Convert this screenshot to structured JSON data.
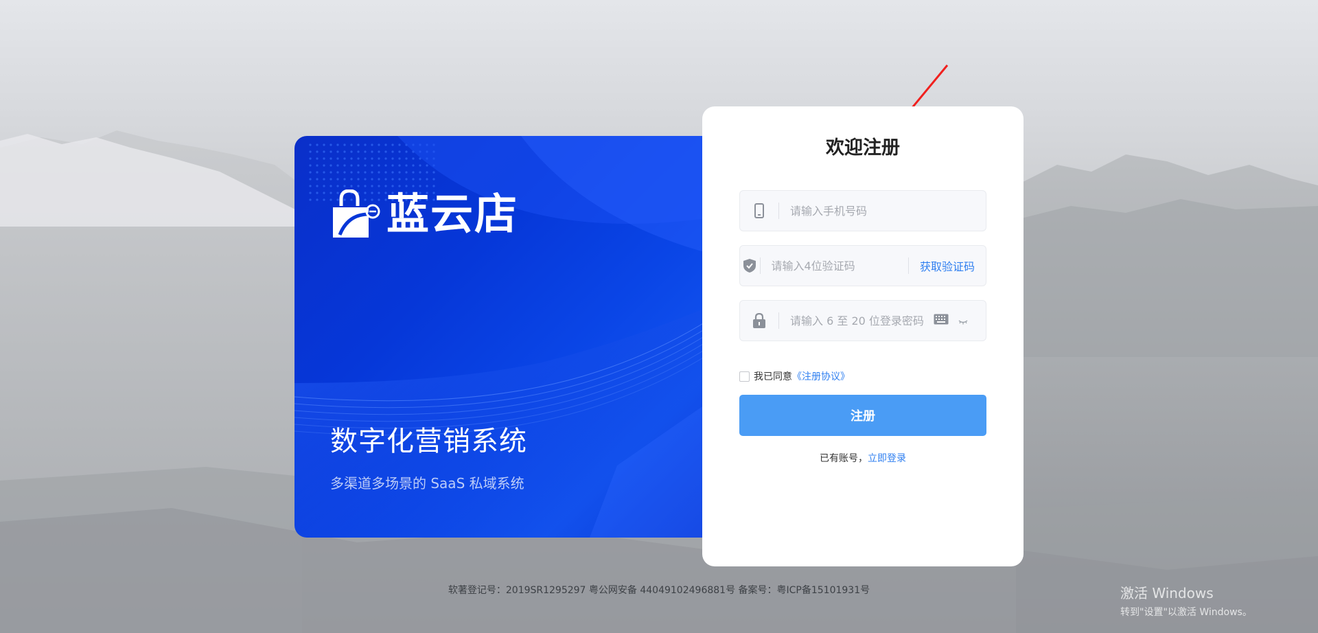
{
  "promo": {
    "brand_name": "蓝云店",
    "title": "数字化营销系统",
    "subtitle": "多渠道多场景的 SaaS 私域系统"
  },
  "register": {
    "title": "欢迎注册",
    "phone_placeholder": "请输入手机号码",
    "code_placeholder": "请输入4位验证码",
    "get_code_label": "获取验证码",
    "password_placeholder": "请输入 6 至 20 位登录密码",
    "agree_prefix": "我已同意",
    "agree_link": "《注册协议》",
    "submit_label": "注册",
    "login_prefix": "已有账号，",
    "login_link": "立即登录"
  },
  "footer": {
    "text": "软著登记号：2019SR1295297 粤公网安备 44049102496881号  备案号：粤ICP备15101931号"
  },
  "watermark": {
    "line1": "激活 Windows",
    "line2": "转到\"设置\"以激活 Windows。"
  },
  "colors": {
    "primary": "#4a9cf5",
    "link": "#2f7ff0",
    "promo_blue": "#0637d8",
    "arrow": "#f0201e"
  }
}
